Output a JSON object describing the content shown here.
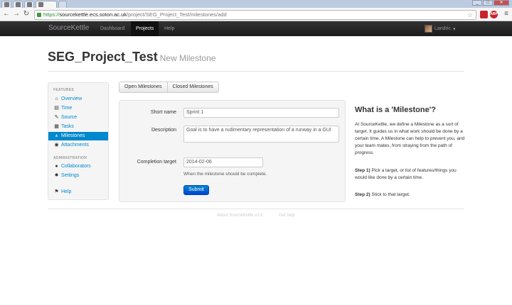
{
  "browser": {
    "url_scheme": "https://",
    "url_host": "sourcekettle.ecs.soton.ac.uk",
    "url_path": "/project/SEG_Project_Test/milestones/add",
    "ext1": "",
    "ext2": "ABP"
  },
  "navbar": {
    "brand": "SourceKettle",
    "links": [
      "Dashboard",
      "Projects",
      "Help"
    ],
    "user": "Landric"
  },
  "header": {
    "title": "SEG_Project_Test",
    "subtitle": "New Milestone"
  },
  "sidebar": {
    "features_header": "FEATURES",
    "features": [
      {
        "label": "Overview",
        "icon": "home-icon",
        "glyph": "⌂"
      },
      {
        "label": "Time",
        "icon": "book-icon",
        "glyph": "▤"
      },
      {
        "label": "Source",
        "icon": "pencil-icon",
        "glyph": "✎"
      },
      {
        "label": "Tasks",
        "icon": "file-icon",
        "glyph": "▦"
      },
      {
        "label": "Milestones",
        "icon": "road-icon",
        "glyph": "⩓"
      },
      {
        "label": "Attachments",
        "icon": "disc-icon",
        "glyph": "◉"
      }
    ],
    "admin_header": "ADMINISTRATION",
    "admin": [
      {
        "label": "Collaborators",
        "icon": "user-icon",
        "glyph": "●"
      },
      {
        "label": "Settings",
        "icon": "cog-icon",
        "glyph": "✹"
      }
    ],
    "help": {
      "label": "Help",
      "icon": "flag-icon",
      "glyph": "⚑"
    }
  },
  "tabs": {
    "open": "Open Milestones",
    "closed": "Closed Milestones"
  },
  "form": {
    "short_name_label": "Short name",
    "short_name_value": "Sprint 1",
    "description_label": "Description",
    "description_value": "Goal is to have a rudimentary representation of a runway in a GUI",
    "target_label": "Completion target",
    "target_value": "2014-02-06",
    "target_help": "When the milestone should be complete.",
    "submit": "Submit"
  },
  "help": {
    "title": "What is a 'Milestone'?",
    "intro": "At SourceKettle, we define a Milestone as a sort of target. It guides us in what work should be done by a certain time. A Milestone can help to prevent you, and your team mates, from straying from the path of progress.",
    "step1_label": "Step 1)",
    "step1_text": "Pick a target, or list of features/things you would like done by a certain time.",
    "step2_label": "Step 2)",
    "step2_text": "Stick to that target."
  },
  "footer": {
    "about": "About SourceKettle v1.6",
    "help": "Get help"
  },
  "colors": {
    "link": "#0088cc",
    "navbar": "#222222",
    "primary_button": "#0044cc"
  }
}
